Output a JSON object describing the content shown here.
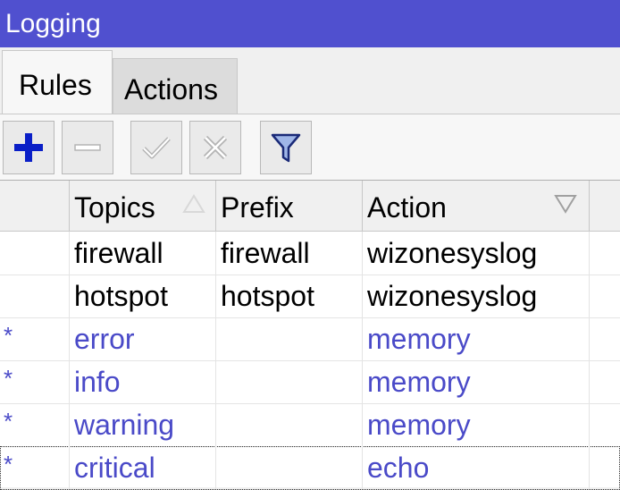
{
  "window": {
    "title": "Logging"
  },
  "tabs": [
    {
      "label": "Rules",
      "active": true
    },
    {
      "label": "Actions",
      "active": false
    }
  ],
  "toolbar": {
    "buttons": [
      {
        "name": "add",
        "icon": "plus-icon",
        "enabled": true
      },
      {
        "name": "remove",
        "icon": "minus-icon",
        "enabled": false
      },
      {
        "name": "enable",
        "icon": "check-icon",
        "enabled": false
      },
      {
        "name": "disable",
        "icon": "x-icon",
        "enabled": false
      },
      {
        "name": "filter",
        "icon": "filter-icon",
        "enabled": true
      }
    ],
    "accent": "#0a1fc7"
  },
  "table": {
    "columns": [
      "Topics",
      "Prefix",
      "Action"
    ],
    "sorted_column": "Topics",
    "rows": [
      {
        "flag": "",
        "topics": "firewall",
        "prefix": "firewall",
        "action": "wizonesyslog",
        "style": "normal"
      },
      {
        "flag": "",
        "topics": "hotspot",
        "prefix": "hotspot",
        "action": "wizonesyslog",
        "style": "normal"
      },
      {
        "flag": "*",
        "topics": "error",
        "prefix": "",
        "action": "memory",
        "style": "default"
      },
      {
        "flag": "*",
        "topics": "info",
        "prefix": "",
        "action": "memory",
        "style": "default"
      },
      {
        "flag": "*",
        "topics": "warning",
        "prefix": "",
        "action": "memory",
        "style": "default"
      },
      {
        "flag": "*",
        "topics": "critical",
        "prefix": "",
        "action": "echo",
        "style": "default"
      }
    ]
  },
  "colors": {
    "titlebar": "#5050cf",
    "default_row_text": "#4a4ac8",
    "normal_row_text": "#000000"
  }
}
